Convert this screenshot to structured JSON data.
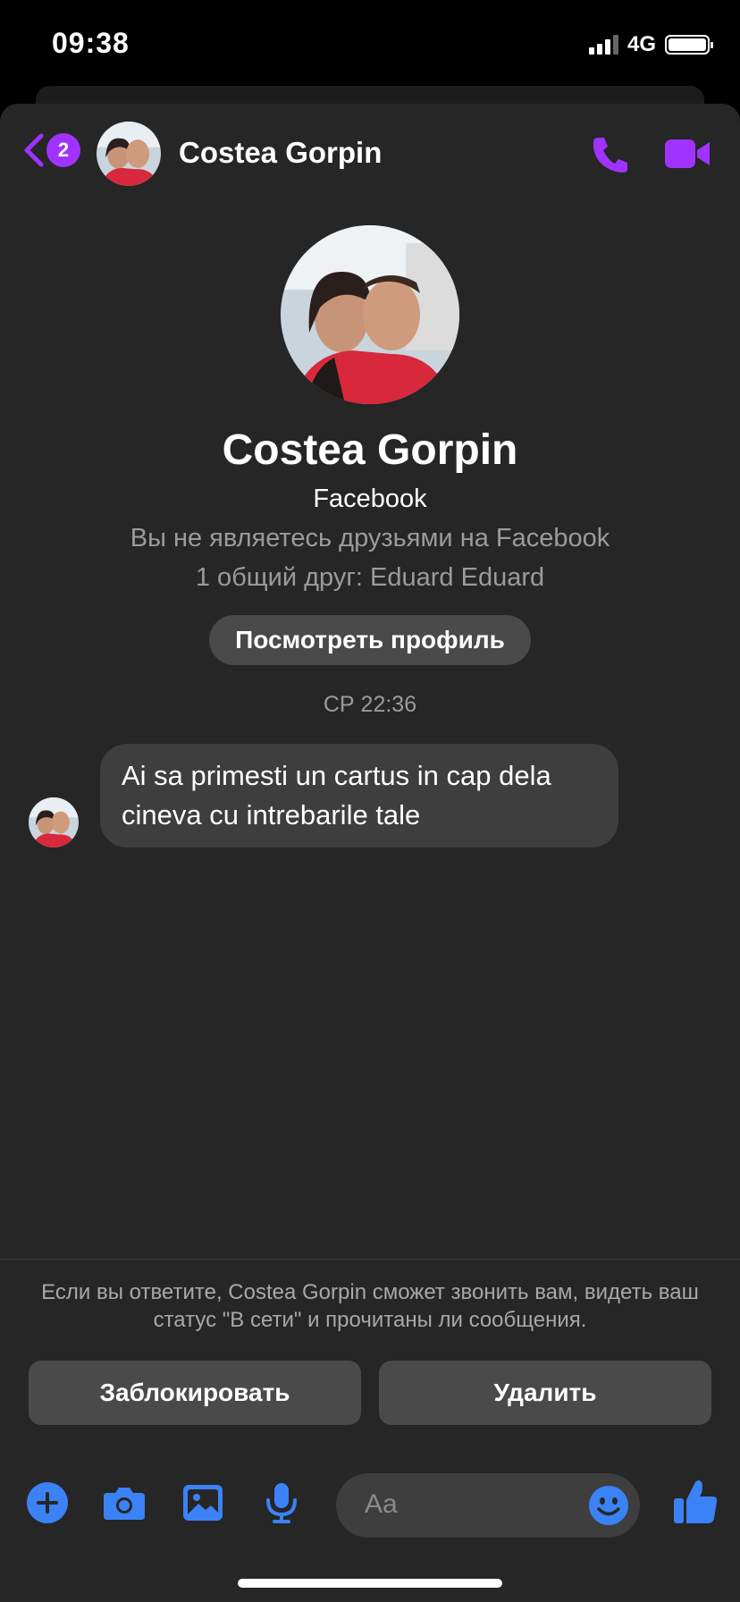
{
  "status_bar": {
    "time": "09:38",
    "network": "4G"
  },
  "header": {
    "back_badge": "2",
    "contact_name": "Costea Gorpin"
  },
  "profile": {
    "name": "Costea Gorpin",
    "source": "Facebook",
    "friend_status": "Вы не являетесь друзьями на Facebook",
    "mutual_friends": "1 общий друг: Eduard Eduard",
    "view_profile_label": "Посмотреть профиль"
  },
  "conversation": {
    "timestamp": "СР 22:36",
    "messages": [
      {
        "text": "Ai sa primesti un cartus in cap dela cineva cu intrebarile tale"
      }
    ]
  },
  "request_notice": {
    "text": "Если вы ответите, Costea Gorpin сможет звонить вам, видеть ваш статус \"В сети\" и прочитаны ли сообщения.",
    "block_label": "Заблокировать",
    "delete_label": "Удалить"
  },
  "composer": {
    "placeholder": "Aa"
  },
  "colors": {
    "accent_purple": "#a033ff",
    "accent_blue": "#3b82f6",
    "background": "#262626"
  },
  "icons": [
    "back-chevron-icon",
    "phone-icon",
    "video-camera-icon",
    "plus-icon",
    "camera-icon",
    "image-icon",
    "microphone-icon",
    "emoji-icon",
    "thumbs-up-icon"
  ]
}
